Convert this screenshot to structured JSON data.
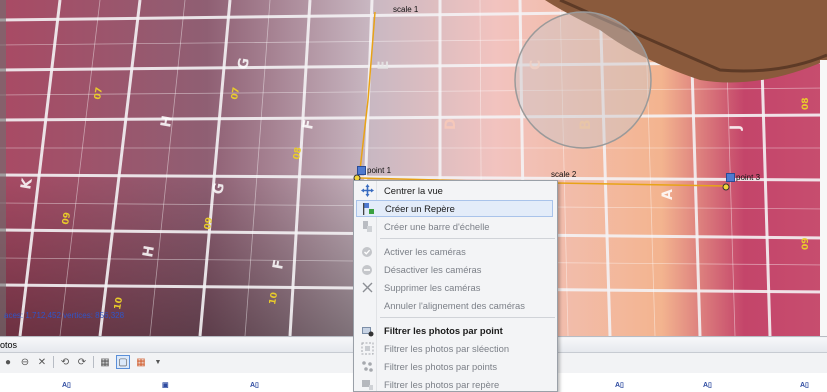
{
  "viewport": {
    "status_text": "aces: 1,712,452 vertices: 856,328",
    "scale_labels": [
      "scale 1",
      "scale 2"
    ],
    "points": [
      "point 1",
      "point 3"
    ],
    "grid_letters": [
      "G",
      "G",
      "H",
      "H",
      "F",
      "F",
      "E",
      "D",
      "C",
      "B",
      "A",
      "J",
      "J",
      "J"
    ],
    "grid_numbers": [
      "07",
      "08",
      "09",
      "10",
      "07",
      "08",
      "09",
      "10",
      "09"
    ]
  },
  "context_menu": {
    "items": [
      {
        "label": "Centrer la vue",
        "icon": "move-icon",
        "state": "normal"
      },
      {
        "label": "Créer un Repère",
        "icon": "marker-icon",
        "state": "hover"
      },
      {
        "label": "Créer une barre d'échelle",
        "icon": "scalebar-icon",
        "state": "disabled"
      },
      {
        "label": "Activer les caméras",
        "icon": "enable-camera-icon",
        "state": "disabled"
      },
      {
        "label": "Désactiver les caméras",
        "icon": "disable-camera-icon",
        "state": "disabled"
      },
      {
        "label": "Supprimer les caméras",
        "icon": "delete-icon",
        "state": "disabled"
      },
      {
        "label": "Annuler l'alignement des caméras",
        "icon": "",
        "state": "disabled"
      },
      {
        "label": "Filtrer les photos par point",
        "icon": "filter-point-icon",
        "state": "bold"
      },
      {
        "label": "Filtrer les photos par sléection",
        "icon": "filter-selection-icon",
        "state": "disabled"
      },
      {
        "label": "Filtrer les photos par points",
        "icon": "filter-points-icon",
        "state": "disabled"
      },
      {
        "label": "Filtrer les photos par repère",
        "icon": "filter-marker-icon",
        "state": "disabled"
      }
    ]
  },
  "photos_panel": {
    "title": "otos"
  },
  "colors": {
    "accent": "#e8a317",
    "status_text": "#2f55c8",
    "menu_hover": "#e3ecf9"
  }
}
